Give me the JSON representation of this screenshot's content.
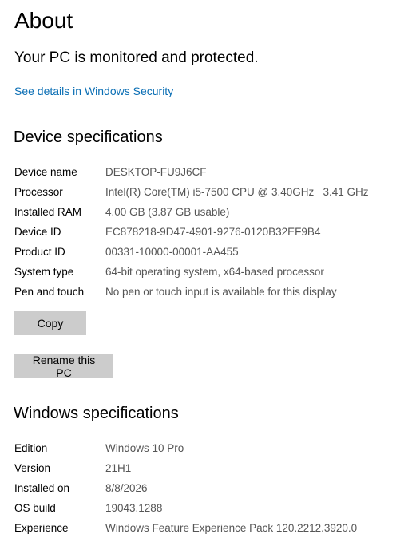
{
  "page": {
    "title": "About",
    "protection_status": "Your PC is monitored and protected.",
    "security_link": "See details in Windows Security"
  },
  "device_specs": {
    "heading": "Device specifications",
    "rows": [
      {
        "label": "Device name",
        "value": "DESKTOP-FU9J6CF"
      },
      {
        "label": "Processor",
        "value": "Intel(R) Core(TM) i5-7500 CPU @ 3.40GHz   3.41 GHz"
      },
      {
        "label": "Installed RAM",
        "value": "4.00 GB (3.87 GB usable)"
      },
      {
        "label": "Device ID",
        "value": "EC878218-9D47-4901-9276-0120B32EF9B4"
      },
      {
        "label": "Product ID",
        "value": "00331-10000-00001-AA455"
      },
      {
        "label": "System type",
        "value": "64-bit operating system, x64-based processor"
      },
      {
        "label": "Pen and touch",
        "value": "No pen or touch input is available for this display"
      }
    ],
    "copy_label": "Copy",
    "rename_label": "Rename this PC"
  },
  "windows_specs": {
    "heading": "Windows specifications",
    "rows": [
      {
        "label": "Edition",
        "value": "Windows 10 Pro"
      },
      {
        "label": "Version",
        "value": "21H1"
      },
      {
        "label": "Installed on",
        "value": "8/8/2026"
      },
      {
        "label": "OS build",
        "value": "19043.1288"
      },
      {
        "label": "Experience",
        "value": "Windows Feature Experience Pack 120.2212.3920.0"
      }
    ]
  },
  "colors": {
    "link": "#0a6eb4",
    "value_text": "#555555",
    "button_bg": "#cccccc"
  }
}
